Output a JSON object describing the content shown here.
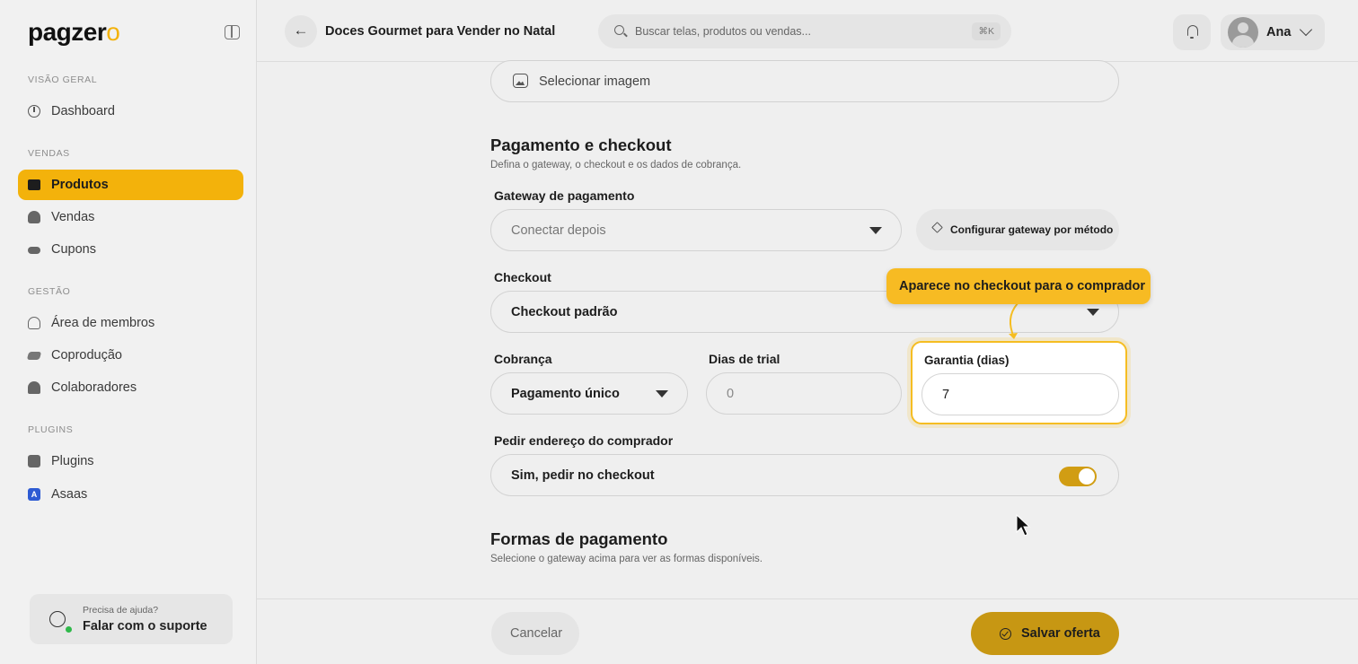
{
  "app": {
    "logo_main": "pagzer",
    "logo_accent": "o"
  },
  "sidebar": {
    "sections": [
      {
        "label": "VISÃO GERAL"
      },
      {
        "label": "VENDAS"
      },
      {
        "label": "GESTÃO"
      },
      {
        "label": "PLUGINS"
      }
    ],
    "items": [
      {
        "label": "Dashboard",
        "icon": "dashboard-icon"
      },
      {
        "label": "Produtos",
        "icon": "products-icon",
        "active": true
      },
      {
        "label": "Vendas",
        "icon": "sales-icon"
      },
      {
        "label": "Cupons",
        "icon": "coupon-icon"
      },
      {
        "label": "Área de membros",
        "icon": "members-icon"
      },
      {
        "label": "Coprodução",
        "icon": "handshake-icon"
      },
      {
        "label": "Colaboradores",
        "icon": "collaborators-icon"
      },
      {
        "label": "Plugins",
        "icon": "puzzle-icon"
      },
      {
        "label": "Asaas",
        "icon": "asaas-icon"
      }
    ],
    "help": {
      "subtitle": "Precisa de ajuda?",
      "title": "Falar com o suporte"
    }
  },
  "header": {
    "title": "Doces Gourmet para Vender no Natal",
    "search_placeholder": "Buscar telas, produtos ou vendas...",
    "shortcut": "⌘K",
    "user_name": "Ana"
  },
  "form": {
    "image_button": "Selecionar imagem",
    "payment_section": {
      "title": "Pagamento e checkout",
      "subtitle": "Defina o gateway, o checkout e os dados de cobrança."
    },
    "gateway": {
      "label": "Gateway de pagamento",
      "placeholder": "Conectar depois",
      "configure_button": "Configurar gateway por método"
    },
    "checkout": {
      "label": "Checkout",
      "value": "Checkout padrão"
    },
    "billing": {
      "label": "Cobrança",
      "value": "Pagamento único"
    },
    "trial": {
      "label": "Dias de trial",
      "placeholder": "0"
    },
    "guarantee": {
      "label": "Garantia (dias)",
      "value": "7"
    },
    "address": {
      "label": "Pedir endereço do comprador",
      "value": "Sim, pedir no checkout",
      "toggle_on": true
    },
    "methods_section": {
      "title": "Formas de pagamento",
      "subtitle": "Selecione o gateway acima para ver as formas disponíveis."
    }
  },
  "tooltip": {
    "text": "Aparece no checkout para o comprador"
  },
  "footer": {
    "cancel": "Cancelar",
    "save": "Salvar oferta"
  },
  "colors": {
    "accent": "#f3b20b",
    "highlight": "#f5bd22"
  }
}
